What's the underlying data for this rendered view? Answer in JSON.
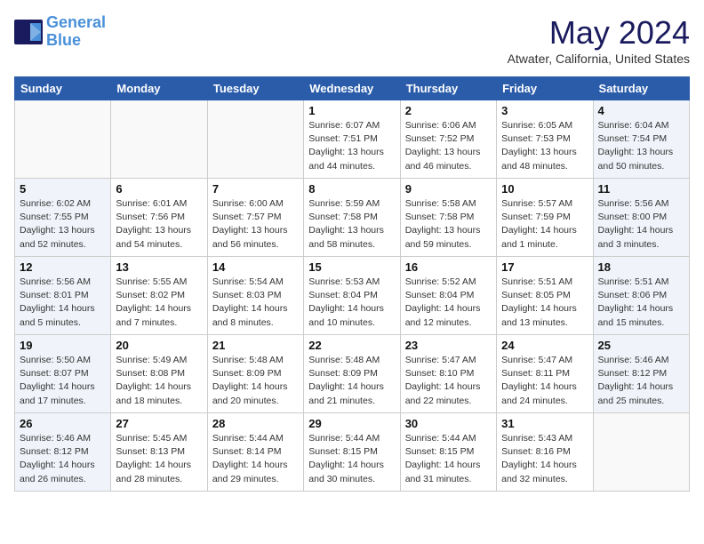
{
  "header": {
    "logo_line1": "General",
    "logo_line2": "Blue",
    "month_title": "May 2024",
    "location": "Atwater, California, United States"
  },
  "days_of_week": [
    "Sunday",
    "Monday",
    "Tuesday",
    "Wednesday",
    "Thursday",
    "Friday",
    "Saturday"
  ],
  "weeks": [
    [
      {
        "num": "",
        "info": "",
        "type": "empty"
      },
      {
        "num": "",
        "info": "",
        "type": "empty"
      },
      {
        "num": "",
        "info": "",
        "type": "empty"
      },
      {
        "num": "1",
        "info": "Sunrise: 6:07 AM\nSunset: 7:51 PM\nDaylight: 13 hours\nand 44 minutes.",
        "type": "weekday"
      },
      {
        "num": "2",
        "info": "Sunrise: 6:06 AM\nSunset: 7:52 PM\nDaylight: 13 hours\nand 46 minutes.",
        "type": "weekday"
      },
      {
        "num": "3",
        "info": "Sunrise: 6:05 AM\nSunset: 7:53 PM\nDaylight: 13 hours\nand 48 minutes.",
        "type": "weekday"
      },
      {
        "num": "4",
        "info": "Sunrise: 6:04 AM\nSunset: 7:54 PM\nDaylight: 13 hours\nand 50 minutes.",
        "type": "weekend"
      }
    ],
    [
      {
        "num": "5",
        "info": "Sunrise: 6:02 AM\nSunset: 7:55 PM\nDaylight: 13 hours\nand 52 minutes.",
        "type": "weekend"
      },
      {
        "num": "6",
        "info": "Sunrise: 6:01 AM\nSunset: 7:56 PM\nDaylight: 13 hours\nand 54 minutes.",
        "type": "weekday"
      },
      {
        "num": "7",
        "info": "Sunrise: 6:00 AM\nSunset: 7:57 PM\nDaylight: 13 hours\nand 56 minutes.",
        "type": "weekday"
      },
      {
        "num": "8",
        "info": "Sunrise: 5:59 AM\nSunset: 7:58 PM\nDaylight: 13 hours\nand 58 minutes.",
        "type": "weekday"
      },
      {
        "num": "9",
        "info": "Sunrise: 5:58 AM\nSunset: 7:58 PM\nDaylight: 13 hours\nand 59 minutes.",
        "type": "weekday"
      },
      {
        "num": "10",
        "info": "Sunrise: 5:57 AM\nSunset: 7:59 PM\nDaylight: 14 hours\nand 1 minute.",
        "type": "weekday"
      },
      {
        "num": "11",
        "info": "Sunrise: 5:56 AM\nSunset: 8:00 PM\nDaylight: 14 hours\nand 3 minutes.",
        "type": "weekend"
      }
    ],
    [
      {
        "num": "12",
        "info": "Sunrise: 5:56 AM\nSunset: 8:01 PM\nDaylight: 14 hours\nand 5 minutes.",
        "type": "weekend"
      },
      {
        "num": "13",
        "info": "Sunrise: 5:55 AM\nSunset: 8:02 PM\nDaylight: 14 hours\nand 7 minutes.",
        "type": "weekday"
      },
      {
        "num": "14",
        "info": "Sunrise: 5:54 AM\nSunset: 8:03 PM\nDaylight: 14 hours\nand 8 minutes.",
        "type": "weekday"
      },
      {
        "num": "15",
        "info": "Sunrise: 5:53 AM\nSunset: 8:04 PM\nDaylight: 14 hours\nand 10 minutes.",
        "type": "weekday"
      },
      {
        "num": "16",
        "info": "Sunrise: 5:52 AM\nSunset: 8:04 PM\nDaylight: 14 hours\nand 12 minutes.",
        "type": "weekday"
      },
      {
        "num": "17",
        "info": "Sunrise: 5:51 AM\nSunset: 8:05 PM\nDaylight: 14 hours\nand 13 minutes.",
        "type": "weekday"
      },
      {
        "num": "18",
        "info": "Sunrise: 5:51 AM\nSunset: 8:06 PM\nDaylight: 14 hours\nand 15 minutes.",
        "type": "weekend"
      }
    ],
    [
      {
        "num": "19",
        "info": "Sunrise: 5:50 AM\nSunset: 8:07 PM\nDaylight: 14 hours\nand 17 minutes.",
        "type": "weekend"
      },
      {
        "num": "20",
        "info": "Sunrise: 5:49 AM\nSunset: 8:08 PM\nDaylight: 14 hours\nand 18 minutes.",
        "type": "weekday"
      },
      {
        "num": "21",
        "info": "Sunrise: 5:48 AM\nSunset: 8:09 PM\nDaylight: 14 hours\nand 20 minutes.",
        "type": "weekday"
      },
      {
        "num": "22",
        "info": "Sunrise: 5:48 AM\nSunset: 8:09 PM\nDaylight: 14 hours\nand 21 minutes.",
        "type": "weekday"
      },
      {
        "num": "23",
        "info": "Sunrise: 5:47 AM\nSunset: 8:10 PM\nDaylight: 14 hours\nand 22 minutes.",
        "type": "weekday"
      },
      {
        "num": "24",
        "info": "Sunrise: 5:47 AM\nSunset: 8:11 PM\nDaylight: 14 hours\nand 24 minutes.",
        "type": "weekday"
      },
      {
        "num": "25",
        "info": "Sunrise: 5:46 AM\nSunset: 8:12 PM\nDaylight: 14 hours\nand 25 minutes.",
        "type": "weekend"
      }
    ],
    [
      {
        "num": "26",
        "info": "Sunrise: 5:46 AM\nSunset: 8:12 PM\nDaylight: 14 hours\nand 26 minutes.",
        "type": "weekend"
      },
      {
        "num": "27",
        "info": "Sunrise: 5:45 AM\nSunset: 8:13 PM\nDaylight: 14 hours\nand 28 minutes.",
        "type": "weekday"
      },
      {
        "num": "28",
        "info": "Sunrise: 5:44 AM\nSunset: 8:14 PM\nDaylight: 14 hours\nand 29 minutes.",
        "type": "weekday"
      },
      {
        "num": "29",
        "info": "Sunrise: 5:44 AM\nSunset: 8:15 PM\nDaylight: 14 hours\nand 30 minutes.",
        "type": "weekday"
      },
      {
        "num": "30",
        "info": "Sunrise: 5:44 AM\nSunset: 8:15 PM\nDaylight: 14 hours\nand 31 minutes.",
        "type": "weekday"
      },
      {
        "num": "31",
        "info": "Sunrise: 5:43 AM\nSunset: 8:16 PM\nDaylight: 14 hours\nand 32 minutes.",
        "type": "weekday"
      },
      {
        "num": "",
        "info": "",
        "type": "empty"
      }
    ]
  ]
}
